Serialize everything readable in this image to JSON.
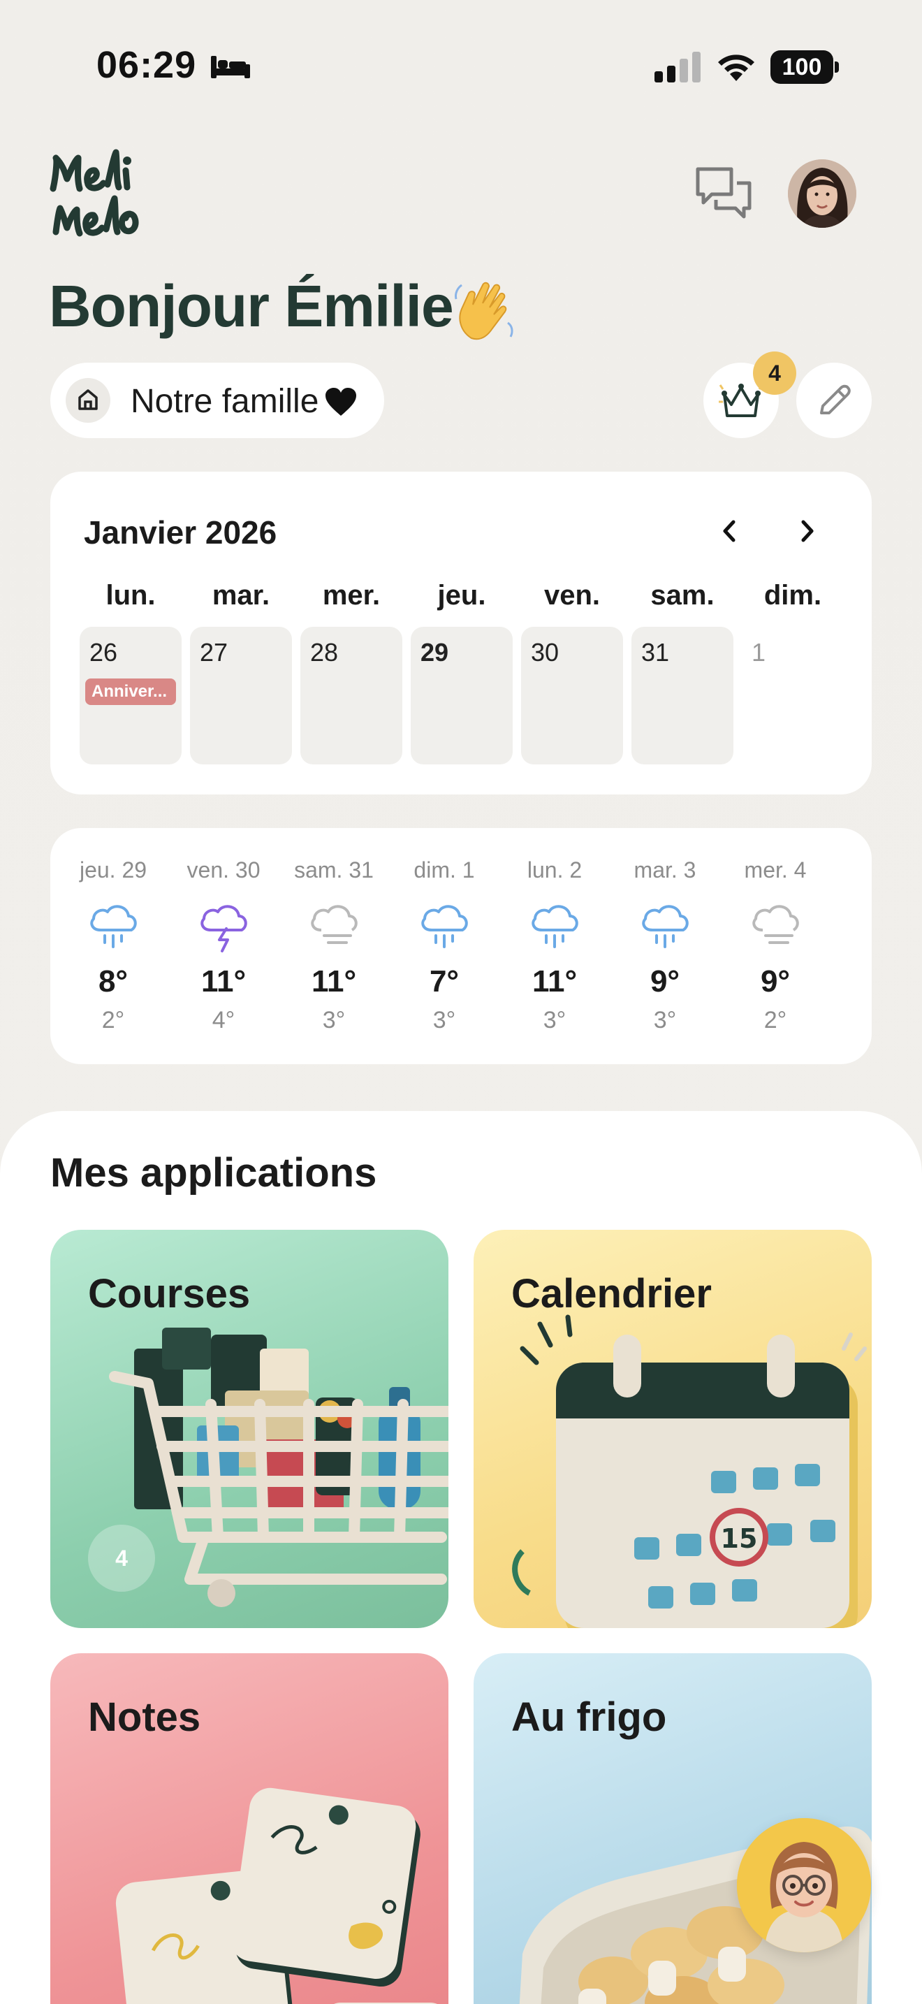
{
  "status_bar": {
    "time": "06:29",
    "battery": "100"
  },
  "header": {
    "greeting": "Bonjour Émilie",
    "family_name": "Notre famille",
    "crown_count": "4"
  },
  "calendar": {
    "title": "Janvier 2026",
    "weekdays": [
      "lun.",
      "mar.",
      "mer.",
      "jeu.",
      "ven.",
      "sam.",
      "dim."
    ],
    "days": [
      {
        "num": "26",
        "event": "Anniver..."
      },
      {
        "num": "27"
      },
      {
        "num": "28"
      },
      {
        "num": "29",
        "today": true
      },
      {
        "num": "30"
      },
      {
        "num": "31"
      },
      {
        "num": "1",
        "outside_month": true
      }
    ]
  },
  "weather": [
    {
      "day": "jeu. 29",
      "icon": "rain-icon",
      "high": "8°",
      "low": "2°"
    },
    {
      "day": "ven. 30",
      "icon": "thunderstorm-icon",
      "high": "11°",
      "low": "4°"
    },
    {
      "day": "sam. 31",
      "icon": "fog-icon",
      "high": "11°",
      "low": "3°"
    },
    {
      "day": "dim. 1",
      "icon": "rain-icon",
      "high": "7°",
      "low": "3°"
    },
    {
      "day": "lun. 2",
      "icon": "rain-icon",
      "high": "11°",
      "low": "3°"
    },
    {
      "day": "mar. 3",
      "icon": "rain-icon",
      "high": "9°",
      "low": "3°"
    },
    {
      "day": "mer. 4",
      "icon": "fog-icon",
      "high": "9°",
      "low": "2°"
    }
  ],
  "apps": {
    "title": "Mes applications",
    "tiles": [
      {
        "label": "Courses",
        "badge": "4"
      },
      {
        "label": "Calendrier"
      },
      {
        "label": "Notes"
      },
      {
        "label": "Au frigo"
      }
    ]
  },
  "colors": {
    "accent_dark_green": "#233a33",
    "event_red": "#d98886",
    "badge_yellow": "#f0c564",
    "rain_blue": "#6aa9e6",
    "storm_purple": "#8a63e0"
  }
}
